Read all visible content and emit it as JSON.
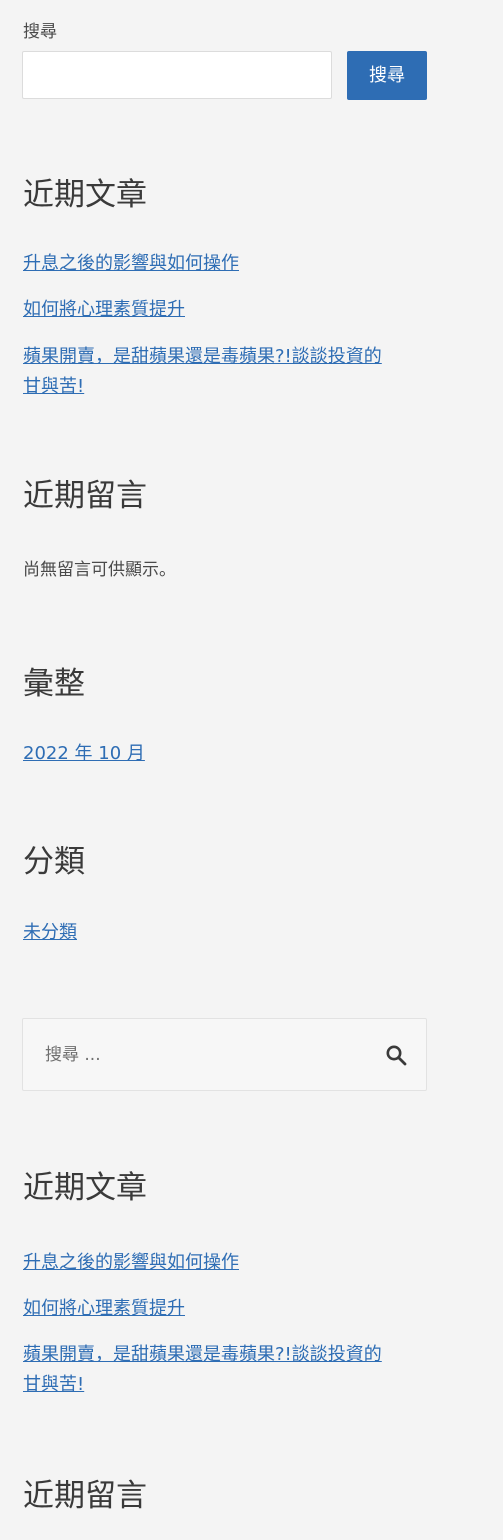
{
  "search_widget": {
    "label": "搜尋",
    "input_value": "",
    "button_label": "搜尋"
  },
  "recent_posts_1": {
    "heading": "近期文章",
    "items": [
      "升息之後的影響與如何操作",
      "如何將心理素質提升",
      "蘋果開賣，是甜蘋果還是毒蘋果?!談談投資的",
      "甘與苦!"
    ]
  },
  "recent_comments_1": {
    "heading": "近期留言",
    "empty_text": "尚無留言可供顯示。"
  },
  "archives": {
    "heading": "彙整",
    "items": [
      "2022 年 10 月"
    ]
  },
  "categories": {
    "heading": "分類",
    "items": [
      "未分類"
    ]
  },
  "search_form_2": {
    "placeholder": "搜尋 ..."
  },
  "recent_posts_2": {
    "heading": "近期文章",
    "items": [
      "升息之後的影響與如何操作",
      "如何將心理素質提升",
      "蘋果開賣，是甜蘋果還是毒蘋果?!談談投資的",
      "甘與苦!"
    ]
  },
  "recent_comments_2": {
    "heading": "近期留言"
  }
}
